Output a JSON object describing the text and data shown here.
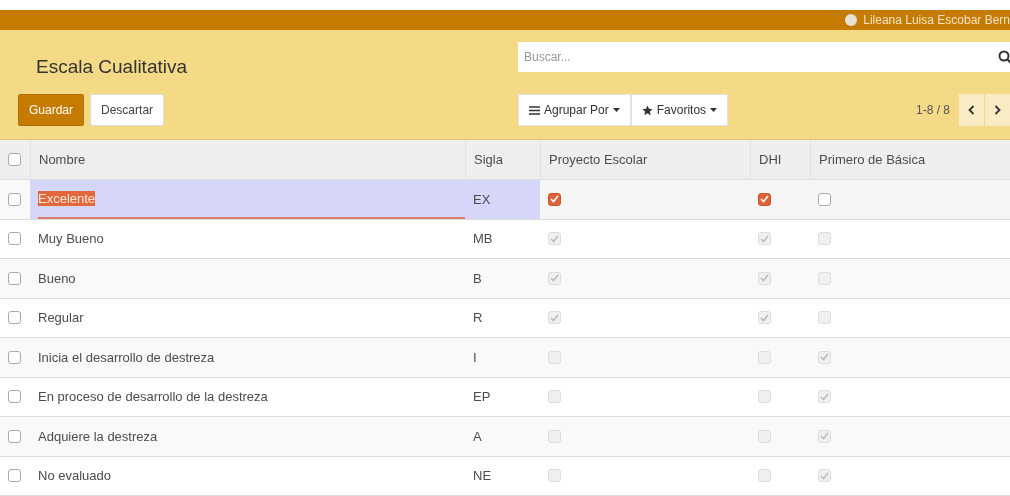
{
  "top_bar": {
    "user_name": "Lileana Luisa Escobar Bern"
  },
  "control_panel": {
    "title": "Escala Cualitativa",
    "search": {
      "placeholder": "Buscar..."
    },
    "buttons": [
      {
        "label": "Guardar",
        "kind": "primary"
      },
      {
        "label": "Descartar",
        "kind": "secondary"
      }
    ],
    "filters": [
      {
        "label": "Agrupar Por",
        "kind": "group"
      },
      {
        "label": "Favoritos",
        "kind": "favorites"
      }
    ],
    "pager": "1-8 / 8"
  },
  "table": {
    "select_all": false,
    "columns": [
      "Nombre",
      "Sigla",
      "Proyecto Escolar",
      "DHI",
      "Primero de Básica"
    ],
    "rows": [
      {
        "selected": false,
        "editing": true,
        "nombre": "Excelente",
        "sigla": "EX",
        "proyecto_escolar": true,
        "dhi": true,
        "primero_de_basica": false
      },
      {
        "selected": false,
        "editing": false,
        "nombre": "Muy Bueno",
        "sigla": "MB",
        "proyecto_escolar": true,
        "dhi": true,
        "primero_de_basica": false
      },
      {
        "selected": false,
        "editing": false,
        "nombre": "Bueno",
        "sigla": "B",
        "proyecto_escolar": true,
        "dhi": true,
        "primero_de_basica": false
      },
      {
        "selected": false,
        "editing": false,
        "nombre": "Regular",
        "sigla": "R",
        "proyecto_escolar": true,
        "dhi": true,
        "primero_de_basica": false
      },
      {
        "selected": false,
        "editing": false,
        "nombre": "Inicia el desarrollo de destreza",
        "sigla": "I",
        "proyecto_escolar": false,
        "dhi": false,
        "primero_de_basica": true
      },
      {
        "selected": false,
        "editing": false,
        "nombre": "En proceso de desarrollo de la destreza",
        "sigla": "EP",
        "proyecto_escolar": false,
        "dhi": false,
        "primero_de_basica": true
      },
      {
        "selected": false,
        "editing": false,
        "nombre": "Adquiere la destreza",
        "sigla": "A",
        "proyecto_escolar": false,
        "dhi": false,
        "primero_de_basica": true
      },
      {
        "selected": false,
        "editing": false,
        "nombre": "No evaluado",
        "sigla": "NE",
        "proyecto_escolar": false,
        "dhi": false,
        "primero_de_basica": true
      }
    ]
  }
}
